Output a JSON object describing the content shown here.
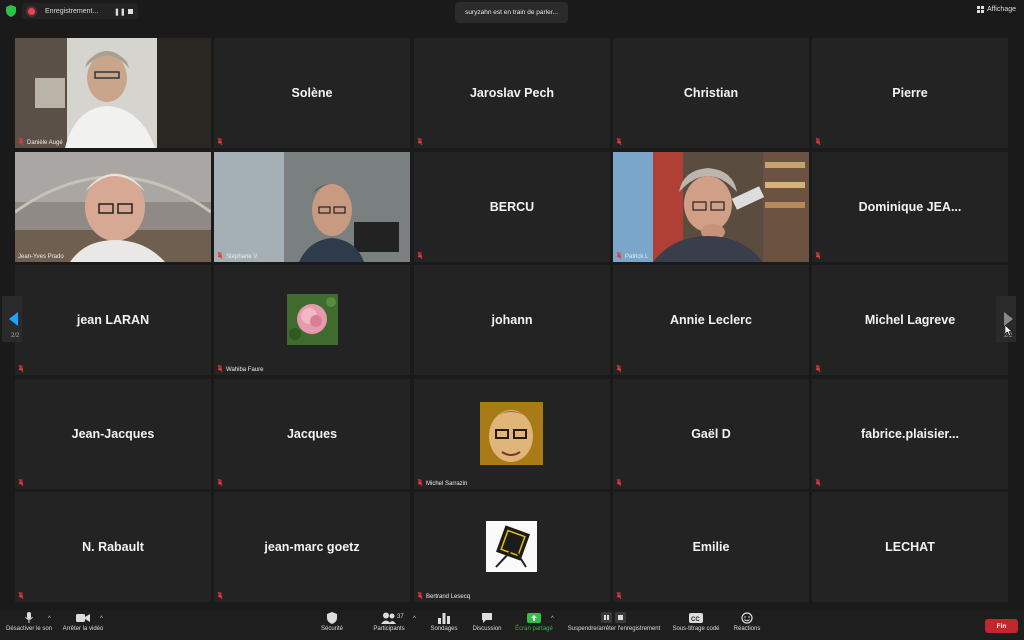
{
  "top": {
    "recording_label": "Enregistrement...",
    "speaking_banner": "suryzahn est en train de parler...",
    "view_label": "Affichage"
  },
  "pagination": {
    "left": "2/2",
    "right": "2/2"
  },
  "tiles": [
    {
      "name": "Danièle Augé",
      "muted": true
    },
    {
      "name": "Solène",
      "muted": true
    },
    {
      "name": "Jaroslav Pech",
      "muted": true
    },
    {
      "name": "Christian",
      "muted": true
    },
    {
      "name": "Pierre",
      "muted": true
    },
    {
      "name": "Jean-Yves Prado",
      "muted": false
    },
    {
      "name": "Stéphane V",
      "muted": true
    },
    {
      "name": "BERCU",
      "muted": true
    },
    {
      "name": "Patrick L",
      "muted": true
    },
    {
      "name": "Dominique  JEA...",
      "muted": true
    },
    {
      "name": "jean  LARAN",
      "muted": true
    },
    {
      "name": "Wahiba Faure",
      "muted": true
    },
    {
      "name": "johann",
      "muted": false
    },
    {
      "name": "Annie Leclerc",
      "muted": true
    },
    {
      "name": "Michel Lagreve",
      "muted": true
    },
    {
      "name": "Jean-Jacques",
      "muted": true
    },
    {
      "name": "Jacques",
      "muted": true
    },
    {
      "name": "Michel Sarrazin",
      "muted": true
    },
    {
      "name": "Gaël D",
      "muted": true
    },
    {
      "name": "fabrice.plaisier...",
      "muted": true
    },
    {
      "name": "N. Rabault",
      "muted": true
    },
    {
      "name": "jean-marc goetz",
      "muted": true
    },
    {
      "name": "Bertrand Lesecq",
      "muted": true
    },
    {
      "name": "Emilie",
      "muted": true
    },
    {
      "name": "LECHAT",
      "muted": false
    }
  ],
  "toolbar": {
    "mute": "Désactiver le son",
    "video": "Arrêter la vidéo",
    "security": "Sécurité",
    "participants": "Participants",
    "participants_count": "37",
    "polls": "Sondages",
    "chat": "Discussion",
    "share": "Écran partagé",
    "recording": "Suspendre/arrêter l'enregistrement",
    "subtitles": "Sous-titrage codé",
    "reactions": "Réactions",
    "end": "Fin"
  },
  "colors": {
    "share_green": "#2fbf4a",
    "end_red": "#c4272b",
    "muted_red": "#e23a3a",
    "page_arrow": "#1aa3ff"
  }
}
